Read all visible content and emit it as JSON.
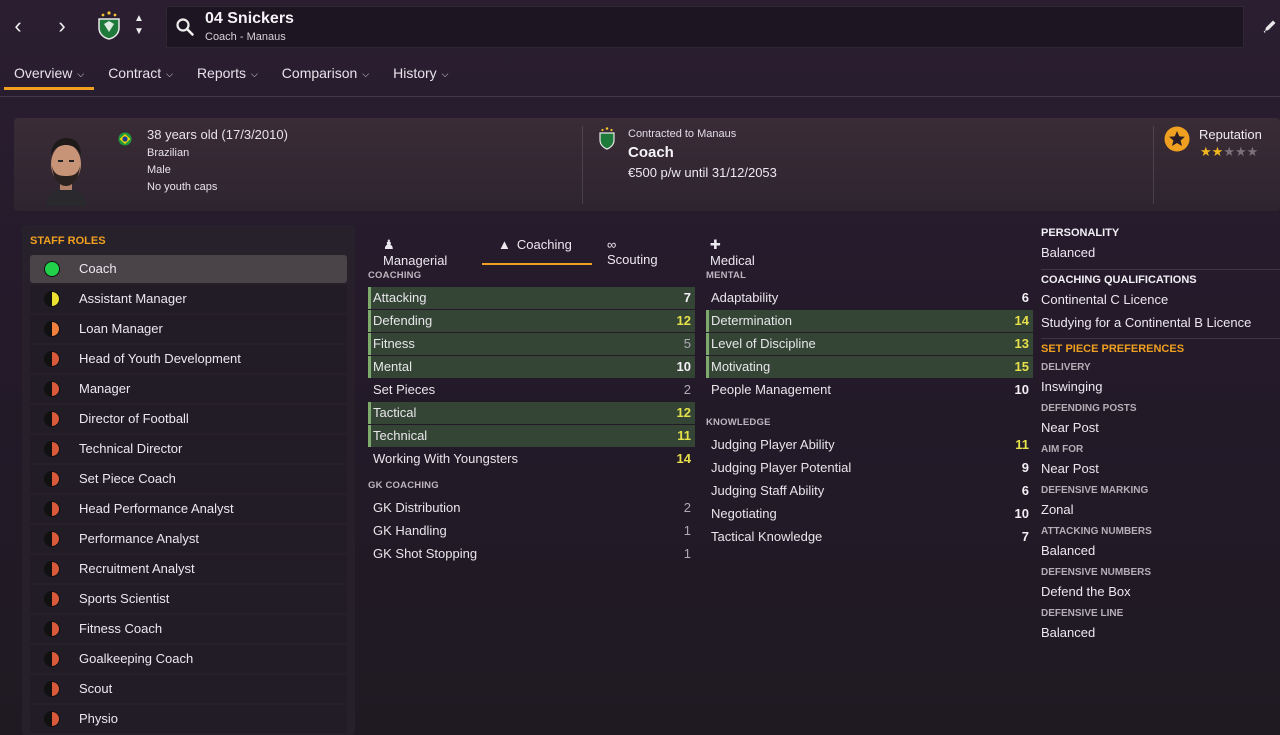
{
  "header": {
    "name": "04 Snickers",
    "subtitle": "Coach - Manaus"
  },
  "tabs": [
    {
      "label": "Overview"
    },
    {
      "label": "Contract"
    },
    {
      "label": "Reports"
    },
    {
      "label": "Comparison"
    },
    {
      "label": "History"
    }
  ],
  "profile": {
    "age_line": "38 years old (17/3/2010)",
    "nationality": "Brazilian",
    "gender": "Male",
    "caps": "No youth caps",
    "contract_to": "Contracted to Manaus",
    "contract_role": "Coach",
    "contract_pay": "€500 p/w until 31/12/2053",
    "reputation_label": "Reputation",
    "reputation_stars": 2,
    "reputation_max": 5
  },
  "roles": {
    "title": "STAFF ROLES",
    "items": [
      {
        "label": "Coach",
        "fill": "full-green"
      },
      {
        "label": "Assistant Manager",
        "fill": "half-yellow"
      },
      {
        "label": "Loan Manager",
        "fill": "half-orange"
      },
      {
        "label": "Head of Youth Development",
        "fill": "half-red"
      },
      {
        "label": "Manager",
        "fill": "half-red"
      },
      {
        "label": "Director of Football",
        "fill": "half-red"
      },
      {
        "label": "Technical Director",
        "fill": "half-red"
      },
      {
        "label": "Set Piece Coach",
        "fill": "half-red"
      },
      {
        "label": "Head Performance Analyst",
        "fill": "half-red"
      },
      {
        "label": "Performance Analyst",
        "fill": "half-red"
      },
      {
        "label": "Recruitment Analyst",
        "fill": "half-red"
      },
      {
        "label": "Sports Scientist",
        "fill": "half-red"
      },
      {
        "label": "Fitness Coach",
        "fill": "half-red"
      },
      {
        "label": "Goalkeeping Coach",
        "fill": "half-red"
      },
      {
        "label": "Scout",
        "fill": "half-red"
      },
      {
        "label": "Physio",
        "fill": "half-red"
      }
    ]
  },
  "subtabs": [
    {
      "label": "Managerial",
      "icon": "person-icon"
    },
    {
      "label": "Coaching",
      "icon": "cone-icon"
    },
    {
      "label": "Scouting",
      "icon": "binoculars-icon"
    },
    {
      "label": "Medical",
      "icon": "medkit-icon"
    }
  ],
  "coaching": {
    "label": "COACHING",
    "items": [
      {
        "name": "Attacking",
        "value": "7",
        "hl": true
      },
      {
        "name": "Defending",
        "value": "12",
        "hl": true
      },
      {
        "name": "Fitness",
        "value": "5",
        "hl": true
      },
      {
        "name": "Mental",
        "value": "10",
        "hl": true
      },
      {
        "name": "Set Pieces",
        "value": "2",
        "hl": false
      },
      {
        "name": "Tactical",
        "value": "12",
        "hl": true
      },
      {
        "name": "Technical",
        "value": "11",
        "hl": true
      },
      {
        "name": "Working With Youngsters",
        "value": "14",
        "hl": false
      }
    ]
  },
  "gk_coaching": {
    "label": "GK COACHING",
    "items": [
      {
        "name": "GK Distribution",
        "value": "2",
        "hl": false
      },
      {
        "name": "GK Handling",
        "value": "1",
        "hl": false
      },
      {
        "name": "GK Shot Stopping",
        "value": "1",
        "hl": false
      }
    ]
  },
  "mental": {
    "label": "MENTAL",
    "items": [
      {
        "name": "Adaptability",
        "value": "6",
        "hl": false
      },
      {
        "name": "Determination",
        "value": "14",
        "hl": true
      },
      {
        "name": "Level of Discipline",
        "value": "13",
        "hl": true
      },
      {
        "name": "Motivating",
        "value": "15",
        "hl": true
      },
      {
        "name": "People Management",
        "value": "10",
        "hl": false
      }
    ]
  },
  "knowledge": {
    "label": "KNOWLEDGE",
    "items": [
      {
        "name": "Judging Player Ability",
        "value": "11",
        "hl": false
      },
      {
        "name": "Judging Player Potential",
        "value": "9",
        "hl": false
      },
      {
        "name": "Judging Staff Ability",
        "value": "6",
        "hl": false
      },
      {
        "name": "Negotiating",
        "value": "10",
        "hl": false
      },
      {
        "name": "Tactical Knowledge",
        "value": "7",
        "hl": false
      }
    ]
  },
  "right": {
    "personality_title": "PERSONALITY",
    "personality": "Balanced",
    "quals_title": "COACHING QUALIFICATIONS",
    "qual1": "Continental C Licence",
    "qual2": "Studying for a Continental B Licence",
    "setpiece_title": "SET PIECE PREFERENCES",
    "prefs": [
      {
        "label": "DELIVERY",
        "value": "Inswinging"
      },
      {
        "label": "DEFENDING POSTS",
        "value": "Near Post"
      },
      {
        "label": "AIM FOR",
        "value": "Near Post"
      },
      {
        "label": "DEFENSIVE MARKING",
        "value": "Zonal"
      },
      {
        "label": "ATTACKING NUMBERS",
        "value": "Balanced"
      },
      {
        "label": "DEFENSIVE NUMBERS",
        "value": "Defend the Box"
      },
      {
        "label": "DEFENSIVE LINE",
        "value": "Balanced"
      }
    ]
  },
  "colors": {
    "accent": "#f0a020",
    "highlight_row": "#344536",
    "value_high": "#e6e04a"
  }
}
